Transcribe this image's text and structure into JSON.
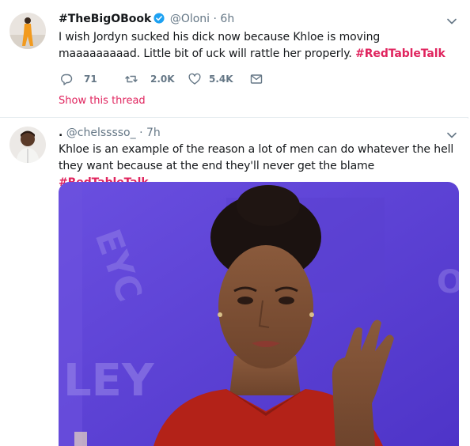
{
  "tweets": [
    {
      "fullname": "#TheBigOBook",
      "handle": "@Oloni",
      "separator": "·",
      "time": "6h",
      "text_plain": "I wish Jordyn sucked his dick now because Khloe is moving maaaaaaaaad. Little bit of uck will rattle her properly. ",
      "hashtag": "#RedTableTalk",
      "replies": "71",
      "retweets": "2.0K",
      "likes": "5.4K",
      "show_thread": "Show this thread",
      "verified": true
    },
    {
      "fullname": ".",
      "handle": "@chelsssso_",
      "separator": "·",
      "time": "7h",
      "text_plain": "Khloe is an example of the reason a lot of men can do whatever the hell they want because at the end they'll never get the blame ",
      "hashtag": "#RedTableTalk",
      "media_caption_letters": [
        "LEY",
        "EYC",
        "OF"
      ]
    }
  ],
  "colors": {
    "accent": "#e0245e",
    "verified": "#1da1f2",
    "secondary_text": "#657786",
    "media_bg": "#5b3fd6"
  },
  "icons": [
    "reply-icon",
    "retweet-icon",
    "like-icon",
    "direct-message-icon",
    "verified-badge-icon",
    "caret-down-icon"
  ]
}
